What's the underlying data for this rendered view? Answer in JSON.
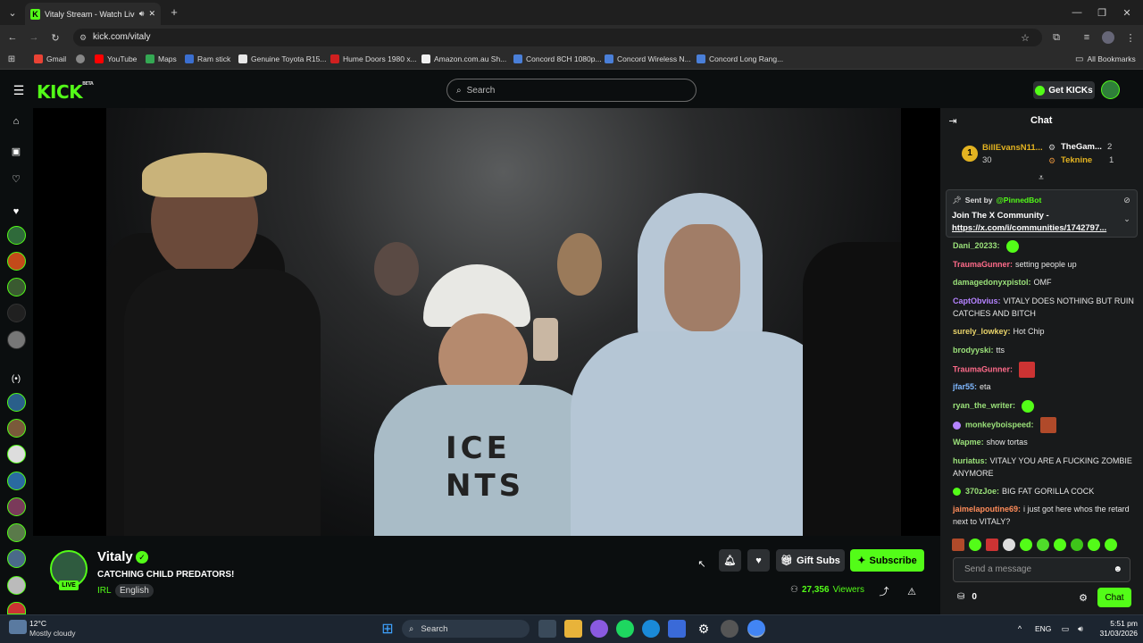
{
  "browser": {
    "tab_title": "Vitaly Stream - Watch Live",
    "url": "kick.com/vitaly",
    "bookmarks": [
      "Gmail",
      "YouTube",
      "Maps",
      "Ram stick",
      "Genuine Toyota R15...",
      "Hume Doors 1980 x...",
      "Amazon.com.au Sh...",
      "Concord 8CH 1080p...",
      "Concord Wireless N...",
      "Concord Long Rang..."
    ],
    "all_bookmarks": "All Bookmarks"
  },
  "header": {
    "logo": "KICK",
    "logo_badge": "BETA",
    "search_placeholder": "Search",
    "get_kicks": "Get KICKs"
  },
  "stream": {
    "channel": "Vitaly",
    "title": "CATCHING CHILD PREDATORS!",
    "category": "IRL",
    "language": "English",
    "live_badge": "LIVE",
    "viewers": "27,356",
    "viewers_label": "Viewers",
    "gift_subs": "Gift Subs",
    "subscribe": "Subscribe",
    "video_shirt_text": "ICE NTS"
  },
  "chat": {
    "title": "Chat",
    "leaderboard": {
      "first": {
        "rank": "1",
        "name": "BillEvansN11...",
        "count": "30"
      },
      "second": {
        "name": "TheGam...",
        "count": "2"
      },
      "third": {
        "name": "Teknine",
        "count": "1"
      }
    },
    "pinned": {
      "sent_by": "Sent by",
      "bot": "@PinnedBot",
      "text": "Join The X Community -",
      "link": "https://x.com/i/communities/1742797..."
    },
    "messages": [
      {
        "user": "Dani_20233:",
        "text": "",
        "color": "#9be27a"
      },
      {
        "user": "TraumaGunner:",
        "text": "setting people up",
        "color": "#ff6b8a"
      },
      {
        "user": "damagedonyxpistol:",
        "text": "OMF",
        "color": "#9be27a"
      },
      {
        "user": "CaptObvius:",
        "text": "VITALY DOES NOTHING BUT RUIN CATCHES AND BITCH",
        "color": "#b583ff"
      },
      {
        "user": "surely_lowkey:",
        "text": "Hot Chip",
        "color": "#e8d36a"
      },
      {
        "user": "brodyyski:",
        "text": "tts",
        "color": "#9be27a"
      },
      {
        "user": "TraumaGunner:",
        "text": "",
        "color": "#ff6b8a"
      },
      {
        "user": "jfar55:",
        "text": "eta",
        "color": "#7fb8ff"
      },
      {
        "user": "ryan_the_writer:",
        "text": "",
        "color": "#9be27a"
      },
      {
        "user": "monkeyboispeed:",
        "text": "",
        "color": "#9be27a"
      },
      {
        "user": "Wapme:",
        "text": "show tortas",
        "color": "#9be27a"
      },
      {
        "user": "huriatus:",
        "text": "VITALY YOU ARE A FUCKING ZOMBIE ANYMORE",
        "color": "#9be27a"
      },
      {
        "user": "370zJoe:",
        "text": "BIG FAT GORILLA COCK",
        "color": "#9be27a"
      },
      {
        "user": "jaimelapoutine69:",
        "text": "i just got here whos the retard next to VITALY?",
        "color": "#ff8c5a"
      }
    ],
    "input_placeholder": "Send a message",
    "kicks_count": "0",
    "chat_button": "Chat"
  },
  "taskbar": {
    "weather_temp": "12°C",
    "weather_desc": "Mostly cloudy",
    "search": "Search",
    "lang": "ENG",
    "time": "5:51 pm",
    "date": "31/03/2026"
  },
  "colors": {
    "accent": "#53fc18",
    "bg": "#0b0e0f",
    "chat_bg": "#181a1b"
  }
}
